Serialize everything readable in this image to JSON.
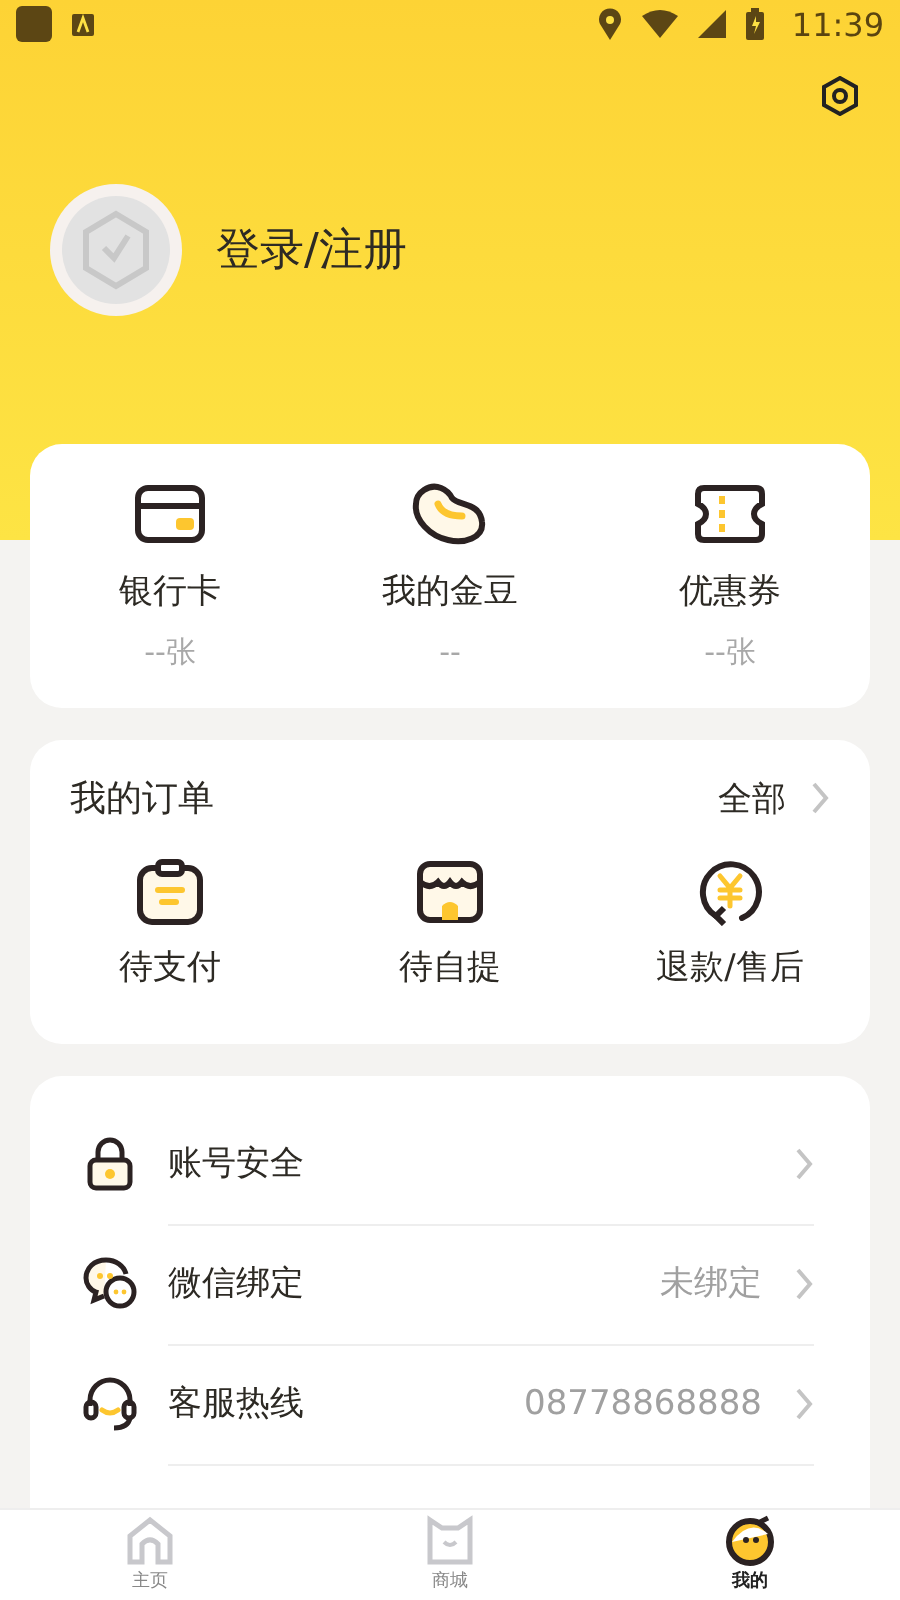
{
  "status_bar": {
    "time": "11:39"
  },
  "profile": {
    "login": "登录/注册"
  },
  "assets": [
    {
      "label": "银行卡",
      "value": "--张"
    },
    {
      "label": "我的金豆",
      "value": "--"
    },
    {
      "label": "优惠券",
      "value": "--张"
    }
  ],
  "orders": {
    "title": "我的订单",
    "all": "全部",
    "items": [
      {
        "label": "待支付"
      },
      {
        "label": "待自提"
      },
      {
        "label": "退款/售后"
      }
    ]
  },
  "menu": [
    {
      "label": "账号安全"
    },
    {
      "label": "微信绑定",
      "value": "未绑定"
    },
    {
      "label": "客服热线",
      "value": "08778868888"
    }
  ],
  "tabs": [
    {
      "label": "主页",
      "selected": false
    },
    {
      "label": "商城",
      "selected": false
    },
    {
      "label": "我的",
      "selected": true
    }
  ]
}
